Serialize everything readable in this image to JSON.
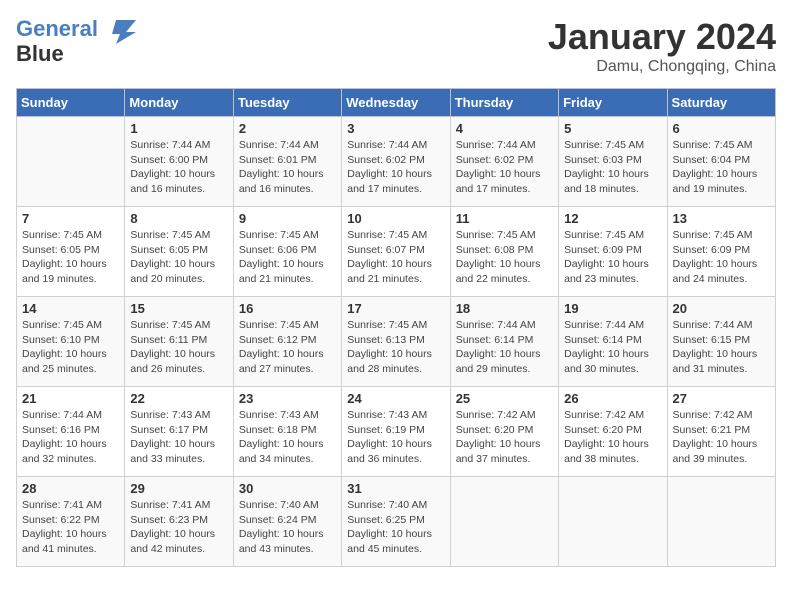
{
  "header": {
    "logo_line1": "General",
    "logo_line2": "Blue",
    "month": "January 2024",
    "location": "Damu, Chongqing, China"
  },
  "weekdays": [
    "Sunday",
    "Monday",
    "Tuesday",
    "Wednesday",
    "Thursday",
    "Friday",
    "Saturday"
  ],
  "weeks": [
    [
      {
        "day": "",
        "info": ""
      },
      {
        "day": "1",
        "info": "Sunrise: 7:44 AM\nSunset: 6:00 PM\nDaylight: 10 hours\nand 16 minutes."
      },
      {
        "day": "2",
        "info": "Sunrise: 7:44 AM\nSunset: 6:01 PM\nDaylight: 10 hours\nand 16 minutes."
      },
      {
        "day": "3",
        "info": "Sunrise: 7:44 AM\nSunset: 6:02 PM\nDaylight: 10 hours\nand 17 minutes."
      },
      {
        "day": "4",
        "info": "Sunrise: 7:44 AM\nSunset: 6:02 PM\nDaylight: 10 hours\nand 17 minutes."
      },
      {
        "day": "5",
        "info": "Sunrise: 7:45 AM\nSunset: 6:03 PM\nDaylight: 10 hours\nand 18 minutes."
      },
      {
        "day": "6",
        "info": "Sunrise: 7:45 AM\nSunset: 6:04 PM\nDaylight: 10 hours\nand 19 minutes."
      }
    ],
    [
      {
        "day": "7",
        "info": "Sunrise: 7:45 AM\nSunset: 6:05 PM\nDaylight: 10 hours\nand 19 minutes."
      },
      {
        "day": "8",
        "info": "Sunrise: 7:45 AM\nSunset: 6:05 PM\nDaylight: 10 hours\nand 20 minutes."
      },
      {
        "day": "9",
        "info": "Sunrise: 7:45 AM\nSunset: 6:06 PM\nDaylight: 10 hours\nand 21 minutes."
      },
      {
        "day": "10",
        "info": "Sunrise: 7:45 AM\nSunset: 6:07 PM\nDaylight: 10 hours\nand 21 minutes."
      },
      {
        "day": "11",
        "info": "Sunrise: 7:45 AM\nSunset: 6:08 PM\nDaylight: 10 hours\nand 22 minutes."
      },
      {
        "day": "12",
        "info": "Sunrise: 7:45 AM\nSunset: 6:09 PM\nDaylight: 10 hours\nand 23 minutes."
      },
      {
        "day": "13",
        "info": "Sunrise: 7:45 AM\nSunset: 6:09 PM\nDaylight: 10 hours\nand 24 minutes."
      }
    ],
    [
      {
        "day": "14",
        "info": "Sunrise: 7:45 AM\nSunset: 6:10 PM\nDaylight: 10 hours\nand 25 minutes."
      },
      {
        "day": "15",
        "info": "Sunrise: 7:45 AM\nSunset: 6:11 PM\nDaylight: 10 hours\nand 26 minutes."
      },
      {
        "day": "16",
        "info": "Sunrise: 7:45 AM\nSunset: 6:12 PM\nDaylight: 10 hours\nand 27 minutes."
      },
      {
        "day": "17",
        "info": "Sunrise: 7:45 AM\nSunset: 6:13 PM\nDaylight: 10 hours\nand 28 minutes."
      },
      {
        "day": "18",
        "info": "Sunrise: 7:44 AM\nSunset: 6:14 PM\nDaylight: 10 hours\nand 29 minutes."
      },
      {
        "day": "19",
        "info": "Sunrise: 7:44 AM\nSunset: 6:14 PM\nDaylight: 10 hours\nand 30 minutes."
      },
      {
        "day": "20",
        "info": "Sunrise: 7:44 AM\nSunset: 6:15 PM\nDaylight: 10 hours\nand 31 minutes."
      }
    ],
    [
      {
        "day": "21",
        "info": "Sunrise: 7:44 AM\nSunset: 6:16 PM\nDaylight: 10 hours\nand 32 minutes."
      },
      {
        "day": "22",
        "info": "Sunrise: 7:43 AM\nSunset: 6:17 PM\nDaylight: 10 hours\nand 33 minutes."
      },
      {
        "day": "23",
        "info": "Sunrise: 7:43 AM\nSunset: 6:18 PM\nDaylight: 10 hours\nand 34 minutes."
      },
      {
        "day": "24",
        "info": "Sunrise: 7:43 AM\nSunset: 6:19 PM\nDaylight: 10 hours\nand 36 minutes."
      },
      {
        "day": "25",
        "info": "Sunrise: 7:42 AM\nSunset: 6:20 PM\nDaylight: 10 hours\nand 37 minutes."
      },
      {
        "day": "26",
        "info": "Sunrise: 7:42 AM\nSunset: 6:20 PM\nDaylight: 10 hours\nand 38 minutes."
      },
      {
        "day": "27",
        "info": "Sunrise: 7:42 AM\nSunset: 6:21 PM\nDaylight: 10 hours\nand 39 minutes."
      }
    ],
    [
      {
        "day": "28",
        "info": "Sunrise: 7:41 AM\nSunset: 6:22 PM\nDaylight: 10 hours\nand 41 minutes."
      },
      {
        "day": "29",
        "info": "Sunrise: 7:41 AM\nSunset: 6:23 PM\nDaylight: 10 hours\nand 42 minutes."
      },
      {
        "day": "30",
        "info": "Sunrise: 7:40 AM\nSunset: 6:24 PM\nDaylight: 10 hours\nand 43 minutes."
      },
      {
        "day": "31",
        "info": "Sunrise: 7:40 AM\nSunset: 6:25 PM\nDaylight: 10 hours\nand 45 minutes."
      },
      {
        "day": "",
        "info": ""
      },
      {
        "day": "",
        "info": ""
      },
      {
        "day": "",
        "info": ""
      }
    ]
  ]
}
